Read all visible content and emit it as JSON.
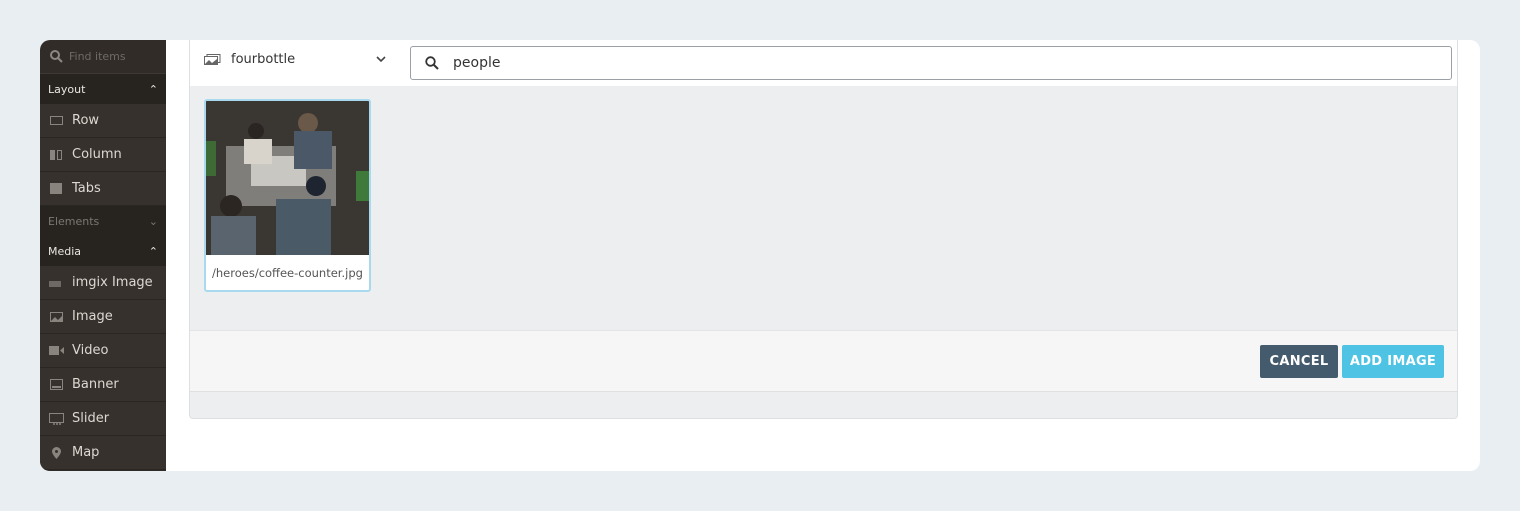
{
  "sidebar": {
    "search_placeholder": "Find items",
    "sections": [
      {
        "label": "Layout",
        "expanded": true,
        "items": [
          {
            "label": "Row",
            "icon": "row-icon"
          },
          {
            "label": "Column",
            "icon": "column-icon"
          },
          {
            "label": "Tabs",
            "icon": "tabs-icon"
          }
        ]
      },
      {
        "label": "Elements",
        "expanded": false,
        "items": []
      },
      {
        "label": "Media",
        "expanded": true,
        "items": [
          {
            "label": "imgix Image",
            "icon": "imgix-icon"
          },
          {
            "label": "Image",
            "icon": "image-icon"
          },
          {
            "label": "Video",
            "icon": "video-icon"
          },
          {
            "label": "Banner",
            "icon": "banner-icon"
          },
          {
            "label": "Slider",
            "icon": "slider-icon"
          },
          {
            "label": "Map",
            "icon": "map-pin-icon"
          }
        ]
      }
    ]
  },
  "picker": {
    "source": "fourbottle",
    "search_value": "people",
    "results": [
      {
        "caption": "/heroes/coffee-counter.jpg",
        "selected": true
      }
    ],
    "cancel_label": "CANCEL",
    "add_label": "ADD IMAGE"
  },
  "colors": {
    "accent": "#4fc3e3",
    "cancel": "#445a6d",
    "sidebar": "#312c28"
  }
}
